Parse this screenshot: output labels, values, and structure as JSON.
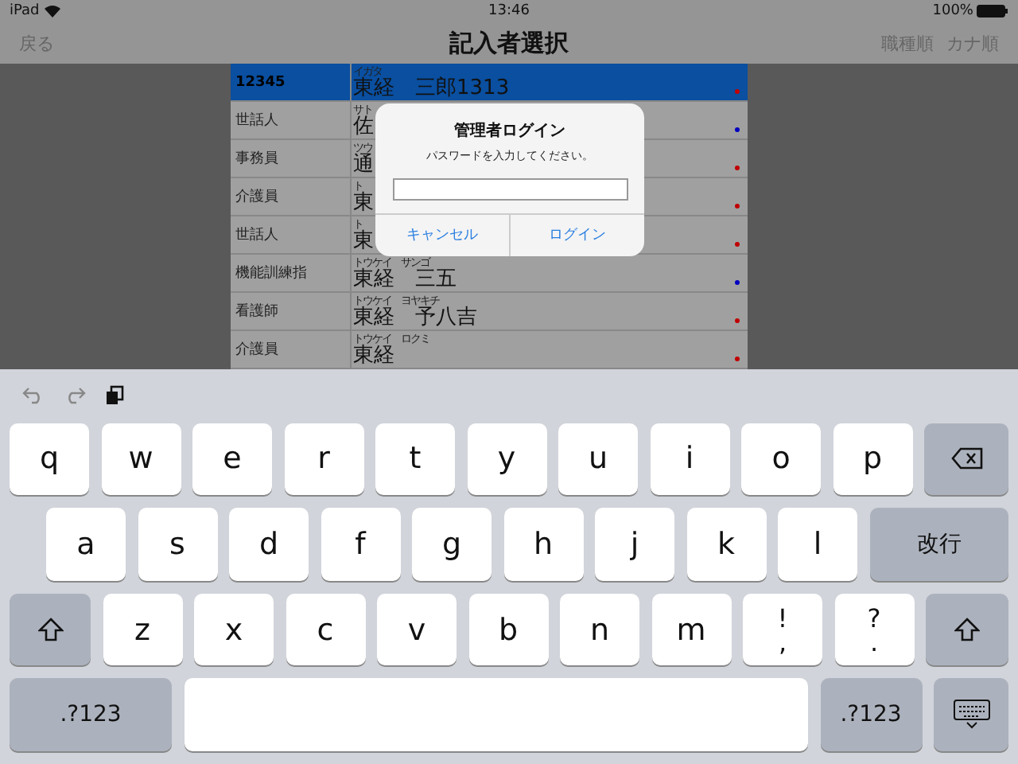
{
  "status_bar": {
    "device": "iPad",
    "time": "13:46",
    "battery": "100%"
  },
  "nav": {
    "back": "戻る",
    "title": "記入者選択",
    "sort_buttons": [
      "職種順",
      "カナ順"
    ]
  },
  "rows": [
    {
      "role": "12345",
      "reading": "イガタ",
      "name": "東経　三郎1313",
      "selected": true,
      "color": "#c00000"
    },
    {
      "role": "世話人",
      "reading": "サト",
      "name": "佐",
      "selected": false,
      "color": "#0000c0"
    },
    {
      "role": "事務員",
      "reading": "ツウ",
      "name": "通",
      "selected": false,
      "color": "#c00000"
    },
    {
      "role": "介護員",
      "reading": "ト",
      "name": "東",
      "selected": false,
      "color": "#c00000"
    },
    {
      "role": "世話人",
      "reading": "ト",
      "name": "東",
      "selected": false,
      "color": "#c00000"
    },
    {
      "role": "機能訓練指",
      "reading": "トウケイ　サンゴ",
      "name": "東経　三五",
      "selected": false,
      "color": "#0000c0"
    },
    {
      "role": "看護師",
      "reading": "トウケイ　ヨヤキチ",
      "name": "東経　予八吉",
      "selected": false,
      "color": "#c00000"
    },
    {
      "role": "介護員",
      "reading": "トウケイ　ロクミ",
      "name": "東経",
      "selected": false,
      "color": "#c00000"
    }
  ],
  "dialog": {
    "title": "管理者ログイン",
    "message": "パスワードを入力してください。",
    "buttons": [
      "キャンセル",
      "ログイン"
    ]
  },
  "keyboard": {
    "rows": [
      {
        "keys": [
          {
            "kind": "letter",
            "label": "q"
          },
          {
            "kind": "letter",
            "label": "w"
          },
          {
            "kind": "letter",
            "label": "e"
          },
          {
            "kind": "letter",
            "label": "r"
          },
          {
            "kind": "letter",
            "label": "t"
          },
          {
            "kind": "letter",
            "label": "y"
          },
          {
            "kind": "letter",
            "label": "u"
          },
          {
            "kind": "letter",
            "label": "i"
          },
          {
            "kind": "letter",
            "label": "o"
          },
          {
            "kind": "letter",
            "label": "p"
          },
          {
            "kind": "backspace"
          }
        ]
      },
      {
        "keys": [
          {
            "kind": "letter",
            "label": "a"
          },
          {
            "kind": "letter",
            "label": "s"
          },
          {
            "kind": "letter",
            "label": "d"
          },
          {
            "kind": "letter",
            "label": "f"
          },
          {
            "kind": "letter",
            "label": "g"
          },
          {
            "kind": "letter",
            "label": "h"
          },
          {
            "kind": "letter",
            "label": "j"
          },
          {
            "kind": "letter",
            "label": "k"
          },
          {
            "kind": "letter",
            "label": "l"
          },
          {
            "kind": "return",
            "label": "改行"
          }
        ]
      },
      {
        "keys": [
          {
            "kind": "shift"
          },
          {
            "kind": "letter",
            "label": "z"
          },
          {
            "kind": "letter",
            "label": "x"
          },
          {
            "kind": "letter",
            "label": "c"
          },
          {
            "kind": "letter",
            "label": "v"
          },
          {
            "kind": "letter",
            "label": "b"
          },
          {
            "kind": "letter",
            "label": "n"
          },
          {
            "kind": "letter",
            "label": "m"
          },
          {
            "kind": "dual",
            "top": "!",
            "bottom": ","
          },
          {
            "kind": "dual",
            "top": "?",
            "bottom": "."
          },
          {
            "kind": "shift"
          }
        ]
      },
      {
        "keys": [
          {
            "kind": "mode",
            "label": ".?123"
          },
          {
            "kind": "space"
          },
          {
            "kind": "mode",
            "label": ".?123"
          },
          {
            "kind": "hide"
          }
        ]
      }
    ]
  }
}
